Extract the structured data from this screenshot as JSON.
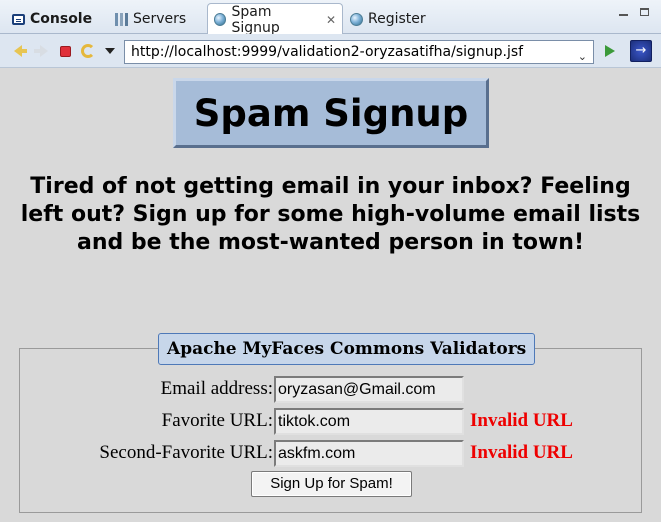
{
  "tabs": [
    {
      "label": "Console",
      "icon": "console-icon",
      "active": false
    },
    {
      "label": "Servers",
      "icon": "servers-icon",
      "active": false
    },
    {
      "label": "Spam Signup",
      "icon": "globe-icon",
      "active": true
    },
    {
      "label": "Register",
      "icon": "globe-icon",
      "active": false
    }
  ],
  "toolbar": {
    "url": "http://localhost:9999/validation2-oryzasatifha/signup.jsf"
  },
  "page": {
    "title": "Spam Signup",
    "intro": "Tired of not getting email in your inbox? Feeling left out? Sign up for some high-volume email lists and be the most-wanted person in town!",
    "legend": "Apache MyFaces Commons Validators",
    "fields": {
      "email": {
        "label": "Email address:",
        "value": "oryzasan@Gmail.com",
        "error": ""
      },
      "favorite_url": {
        "label": "Favorite URL:",
        "value": "tiktok.com",
        "error": "Invalid URL"
      },
      "second_url": {
        "label": "Second-Favorite URL:",
        "value": "askfm.com",
        "error": "Invalid URL"
      }
    },
    "submit_label": "Sign Up for Spam!"
  },
  "colors": {
    "title_bg": "#a6bcd8",
    "legend_bg": "#c7d6ea",
    "error": "#ee0000"
  }
}
